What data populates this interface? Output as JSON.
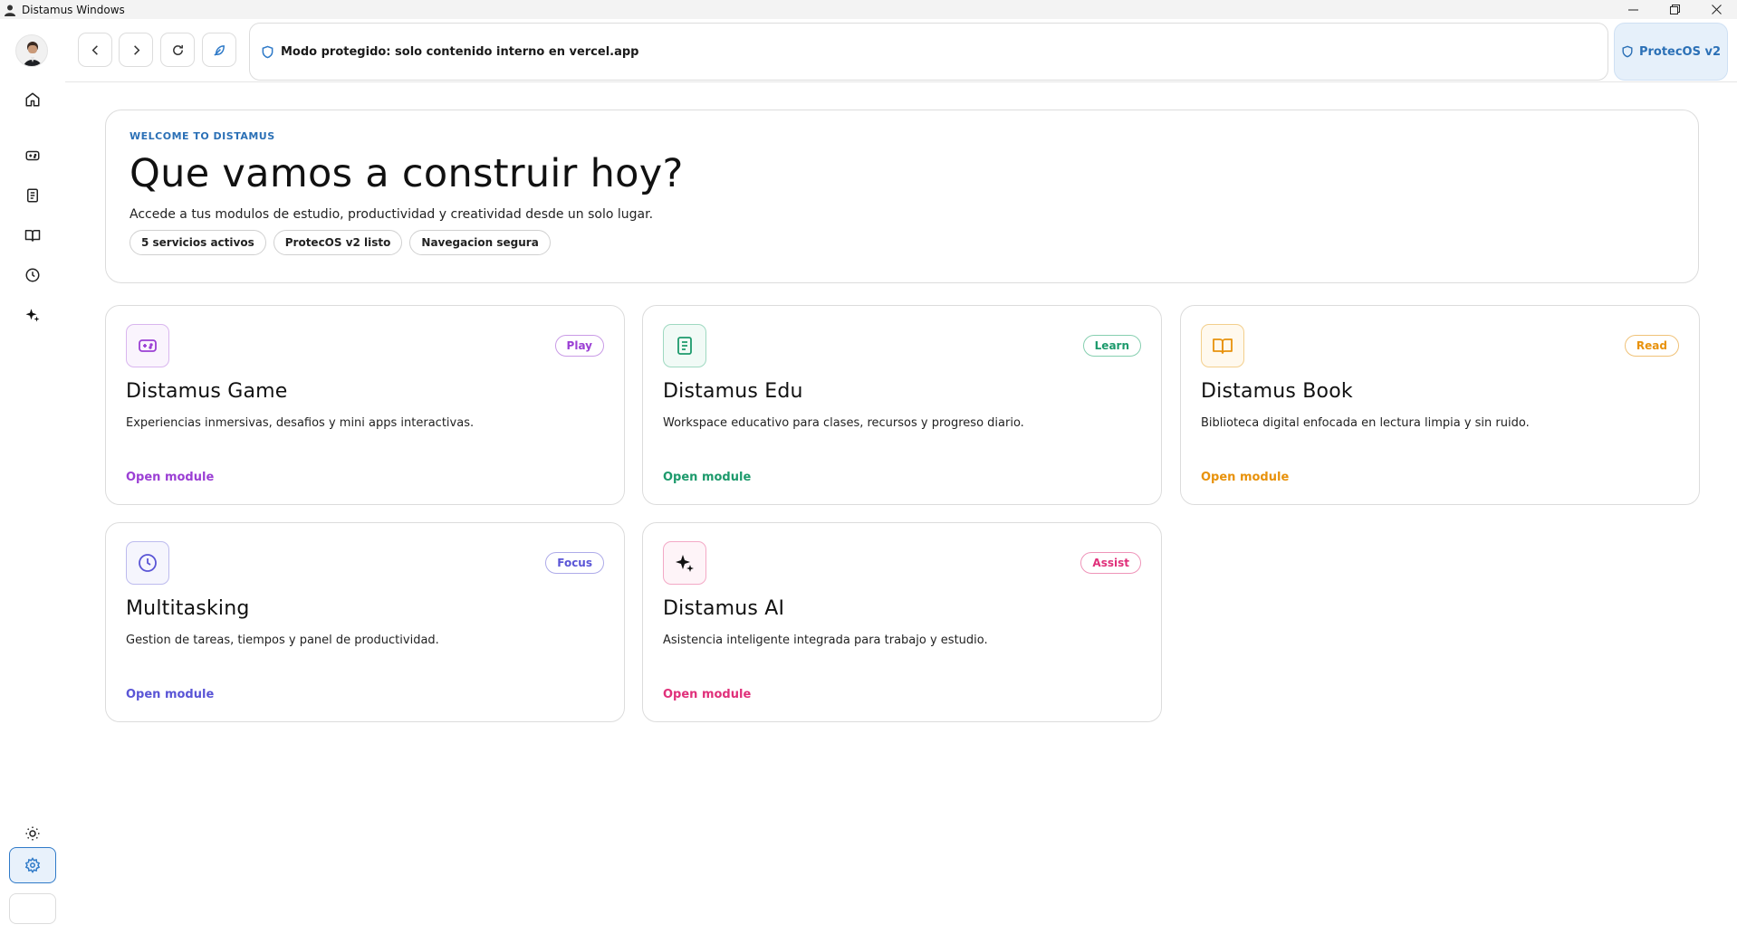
{
  "window": {
    "title": "Distamus Windows"
  },
  "toolbar": {
    "address_text": "Modo protegido: solo contenido interno en vercel.app",
    "protecos_label": "ProtecOS v2"
  },
  "hero": {
    "eyebrow": "WELCOME TO DISTAMUS",
    "title": "Que vamos a construir hoy?",
    "subtitle": "Accede a tus modulos de estudio, productividad y creatividad desde un solo lugar.",
    "chips": [
      "5 servicios activos",
      "ProtecOS v2 listo",
      "Navegacion segura"
    ]
  },
  "cards": [
    {
      "title": "Distamus Game",
      "badge": "Play",
      "desc": "Experiencias inmersivas, desafios y mini apps interactivas.",
      "link": "Open module",
      "color": "#9b3fd4",
      "icon": "gamepad-icon"
    },
    {
      "title": "Distamus Edu",
      "badge": "Learn",
      "desc": "Workspace educativo para clases, recursos y progreso diario.",
      "link": "Open module",
      "color": "#1d9a6c",
      "icon": "notebook-icon"
    },
    {
      "title": "Distamus Book",
      "badge": "Read",
      "desc": "Biblioteca digital enfocada en lectura limpia y sin ruido.",
      "link": "Open module",
      "color": "#e8920c",
      "icon": "book-icon"
    },
    {
      "title": "Multitasking",
      "badge": "Focus",
      "desc": "Gestion de tareas, tiempos y panel de productividad.",
      "link": "Open module",
      "color": "#5a55d6",
      "icon": "clock-icon"
    },
    {
      "title": "Distamus AI",
      "badge": "Assist",
      "desc": "Asistencia inteligente integrada para trabajo y estudio.",
      "link": "Open module",
      "color": "#e0307a",
      "icon": "sparkle-icon"
    }
  ]
}
